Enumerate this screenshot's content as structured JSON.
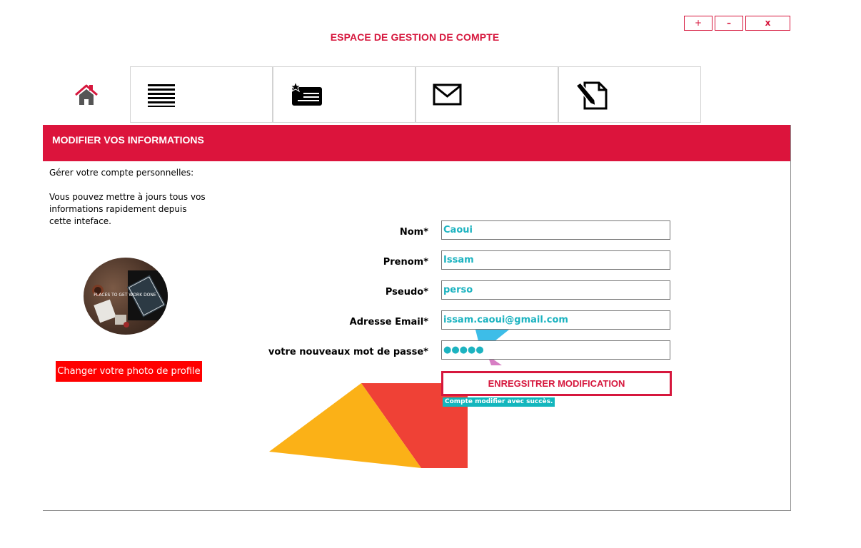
{
  "window_controls": {
    "maximize": "+",
    "minimize": "–",
    "close": "x"
  },
  "app_title": "ESPACE DE GESTION DE COMPTE",
  "nav": {
    "home_icon": "home-icon",
    "tabs": [
      {
        "icon": "list-icon"
      },
      {
        "icon": "starred-card-icon"
      },
      {
        "icon": "envelope-icon"
      },
      {
        "icon": "edit-document-icon"
      }
    ]
  },
  "panel": {
    "title": "MODIFIER VOS INFORMATIONS"
  },
  "intro": {
    "heading": "Gérer votre compte personnelles:",
    "body": "Vous pouvez mettre à jours tous vos informations rapidement depuis cette inteface."
  },
  "profile": {
    "photo_text": "PLACES TO GET WORK DONE",
    "change_photo_label": "Changer votre photo de profile"
  },
  "form": {
    "nom": {
      "label": "Nom*",
      "value": "Caoui"
    },
    "prenom": {
      "label": "Prenom*",
      "value": "Issam"
    },
    "pseudo": {
      "label": "Pseudo*",
      "value": "perso"
    },
    "email": {
      "label": "Adresse Email*",
      "value": "issam.caoui@gmail.com"
    },
    "password": {
      "label": "votre nouveaux mot de passe*",
      "value": "●●●●●"
    },
    "save_label": "ENREGSITRER MODIFICATION",
    "success_message": "Compte modifier avec succès."
  },
  "colors": {
    "accent": "#dc143c",
    "input_text": "#1cb3c0",
    "success_bg": "#13b6bd",
    "photo_button": "#ff0000"
  }
}
